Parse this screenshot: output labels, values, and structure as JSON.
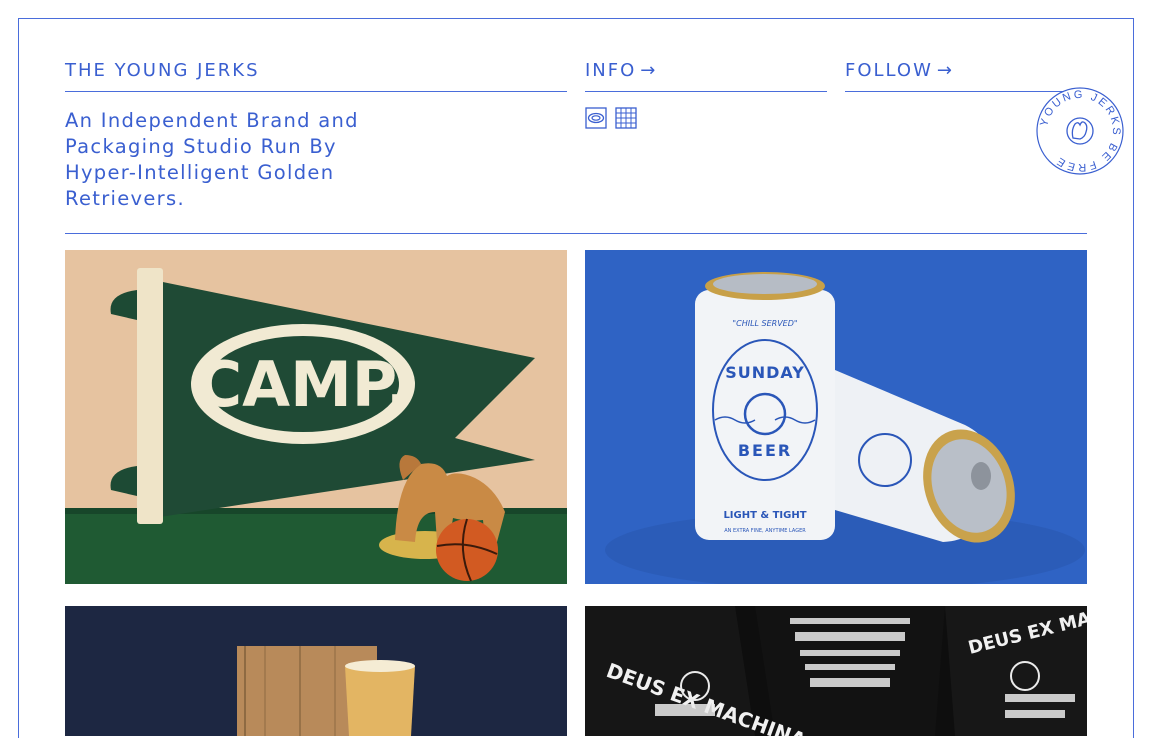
{
  "brand": {
    "name": "THE YOUNG JERKS"
  },
  "nav": {
    "info_label": "INFO",
    "follow_label": "FOLLOW",
    "arrow": "→"
  },
  "tagline": "An Independent Brand and Packaging Studio Run By Hyper-Intelligent Golden Retrievers.",
  "view_toggle": {
    "icons": [
      "single-view-icon",
      "grid-view-icon"
    ]
  },
  "badge": {
    "text": "YOUNG JERKS BE FREE"
  },
  "projects": [
    {
      "name": "camp-pennant",
      "logo_text": "CAMP."
    },
    {
      "name": "sunday-beer",
      "can_top": "\"CHILL SERVED\"",
      "can_name_1": "SUNDAY",
      "can_name_2": "BEER",
      "can_tag": "LIGHT & TIGHT",
      "can_foot": "AN EXTRA FINE, ANYTIME LAGER"
    },
    {
      "name": "beer-glass"
    },
    {
      "name": "deus-ex-machina-tees",
      "shirt_text": "DEUS EX MACHINA"
    }
  ],
  "colors": {
    "accent": "#3a5fd0",
    "camp_green": "#1f4a35",
    "camp_bg": "#e8c4a2",
    "beer_blue": "#2f63c4",
    "dark_navy": "#1d2742",
    "tee_black": "#0e0e0e"
  }
}
